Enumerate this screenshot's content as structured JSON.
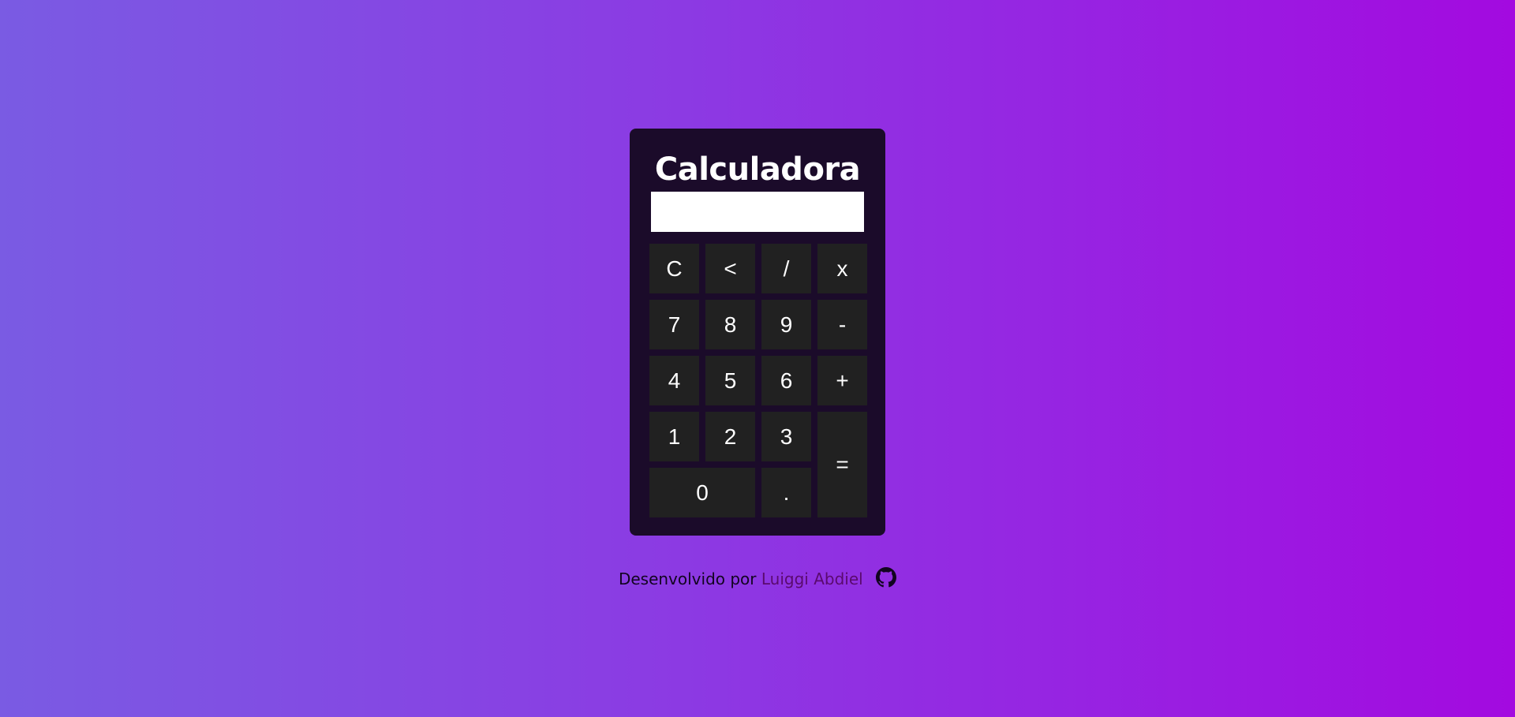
{
  "calculator": {
    "title": "Calculadora",
    "display_value": "",
    "keys": {
      "clear": "C",
      "backspace": "<",
      "divide": "/",
      "multiply": "x",
      "seven": "7",
      "eight": "8",
      "nine": "9",
      "minus": "-",
      "four": "4",
      "five": "5",
      "six": "6",
      "plus": "+",
      "one": "1",
      "two": "2",
      "three": "3",
      "equals": "=",
      "zero": "0",
      "decimal": "."
    }
  },
  "footer": {
    "text": "Desenvolvido por",
    "author_link": "Luiggi Abdiel",
    "icon": "github-icon"
  },
  "colors": {
    "calculator_bg": "#1b0b2a",
    "key_bg": "#212121",
    "link": "#5a0a6e",
    "gradient_start": "#7a5be3",
    "gradient_end": "#a30ae0"
  }
}
